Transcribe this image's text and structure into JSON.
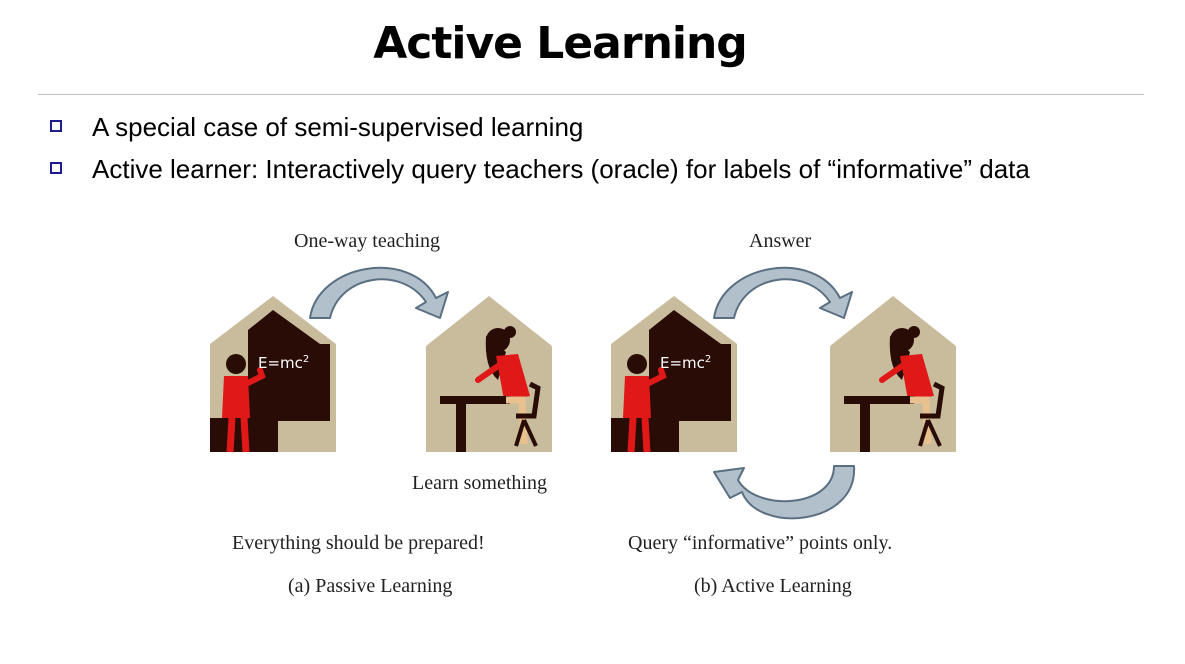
{
  "slide": {
    "title": "Active Learning",
    "bullets": [
      {
        "text": "A special case of semi-supervised learning"
      },
      {
        "text": "Active learner: Interactively query teachers (oracle) for labels of “informative” data"
      }
    ]
  },
  "figure": {
    "passive": {
      "arrow_label": "One-way teaching",
      "student_label": "Learn something",
      "note": "Everything should be prepared!",
      "caption": "(a) Passive Learning",
      "equation": "E=mc",
      "exponent": "2"
    },
    "active": {
      "arrow_label": "Answer",
      "query_note": "Query “informative” points only.",
      "caption": "(b) Active Learning",
      "equation": "E=mc",
      "exponent": "2"
    }
  },
  "colors": {
    "bullet_box": "#1c1c8c",
    "house": "#c9bc9c",
    "board": "#2a0c06",
    "figure_red": "#e01818",
    "arrow_fill": "#b2c0cc",
    "arrow_stroke": "#5b6f82"
  }
}
